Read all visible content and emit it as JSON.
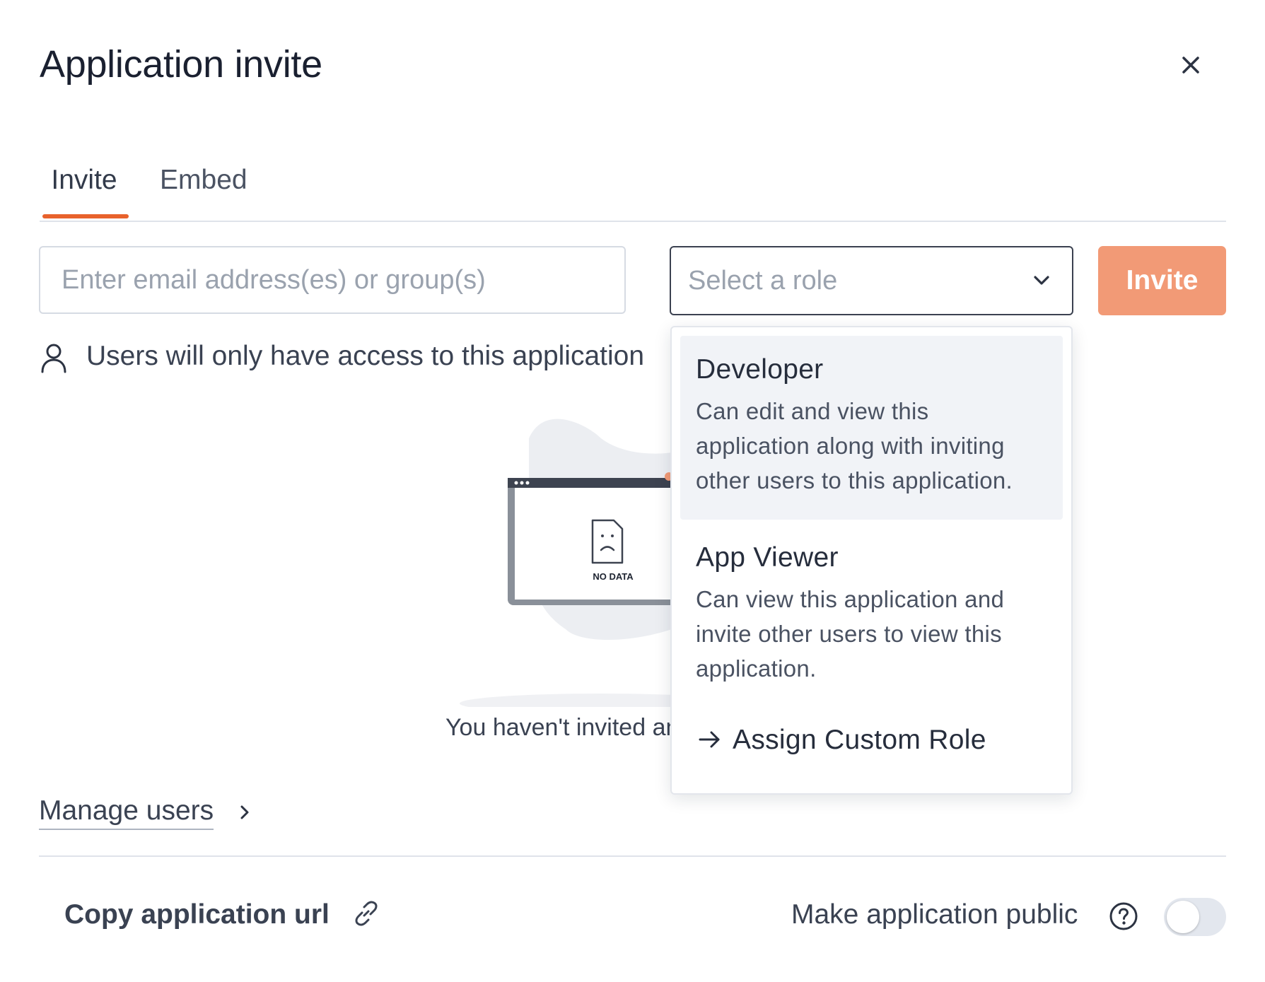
{
  "dialog": {
    "title": "Application invite"
  },
  "tabs": [
    {
      "label": "Invite",
      "active": true
    },
    {
      "label": "Embed",
      "active": false
    }
  ],
  "invite_form": {
    "email_placeholder": "Enter email address(es) or group(s)",
    "email_value": "",
    "role_placeholder": "Select a role",
    "invite_label": "Invite"
  },
  "access_note": "Users will only have access to this application",
  "empty_state": {
    "illustration_label": "NO DATA",
    "message": "You haven't invited any users yet"
  },
  "role_dropdown": {
    "options": [
      {
        "title": "Developer",
        "description": "Can edit and view this application along with inviting other users to this application."
      },
      {
        "title": "App Viewer",
        "description": "Can view this application and invite other users to view this application."
      }
    ],
    "custom_role_label": "Assign Custom Role"
  },
  "manage_users_label": "Manage users",
  "footer": {
    "copy_url_label": "Copy application url",
    "public_label": "Make application public",
    "public_enabled": false
  },
  "colors": {
    "accent": "#e8622c",
    "invite_button": "#f29a76",
    "dropdown_hover": "#f1f3f7",
    "toggle_off": "#e3e7ee"
  },
  "icons": [
    "close-icon",
    "chevron-down-icon",
    "user-icon",
    "chevron-right-icon",
    "arrow-right-icon",
    "link-icon",
    "help-icon"
  ]
}
